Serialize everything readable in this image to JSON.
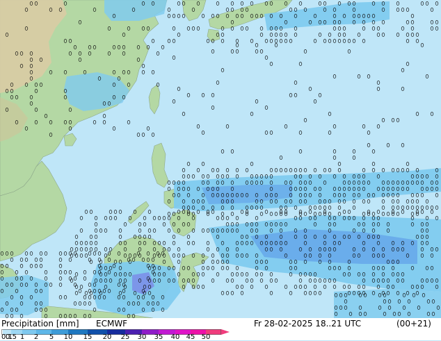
{
  "footer": {
    "title": "Precipitation [mm]",
    "model": "ECMWF",
    "datetime": "Fr 28-02-2025 18..21 UTC",
    "validity": "(00+21)"
  },
  "legend": {
    "ticks": [
      "0.1",
      "0.5",
      "1",
      "2",
      "5",
      "10",
      "15",
      "20",
      "25",
      "30",
      "35",
      "40",
      "45",
      "50"
    ],
    "colors": [
      "#bfe6f8",
      "#9fd8f4",
      "#7fc9ef",
      "#5fb7e8",
      "#3e9cd8",
      "#1f78c0",
      "#1050aa",
      "#162b9d",
      "#4b1fb0",
      "#8f1cc8",
      "#c21ad2",
      "#e014c8",
      "#ee12a8",
      "#f03c7c"
    ]
  },
  "map_colors": {
    "ocean": "#bfe6f8",
    "land": "#b4d8a4",
    "land_high": "#d8c9a0",
    "rain": "#80cbef",
    "rain_heavy": "#5f9fe8",
    "rain_violet": "#7a88e8"
  }
}
